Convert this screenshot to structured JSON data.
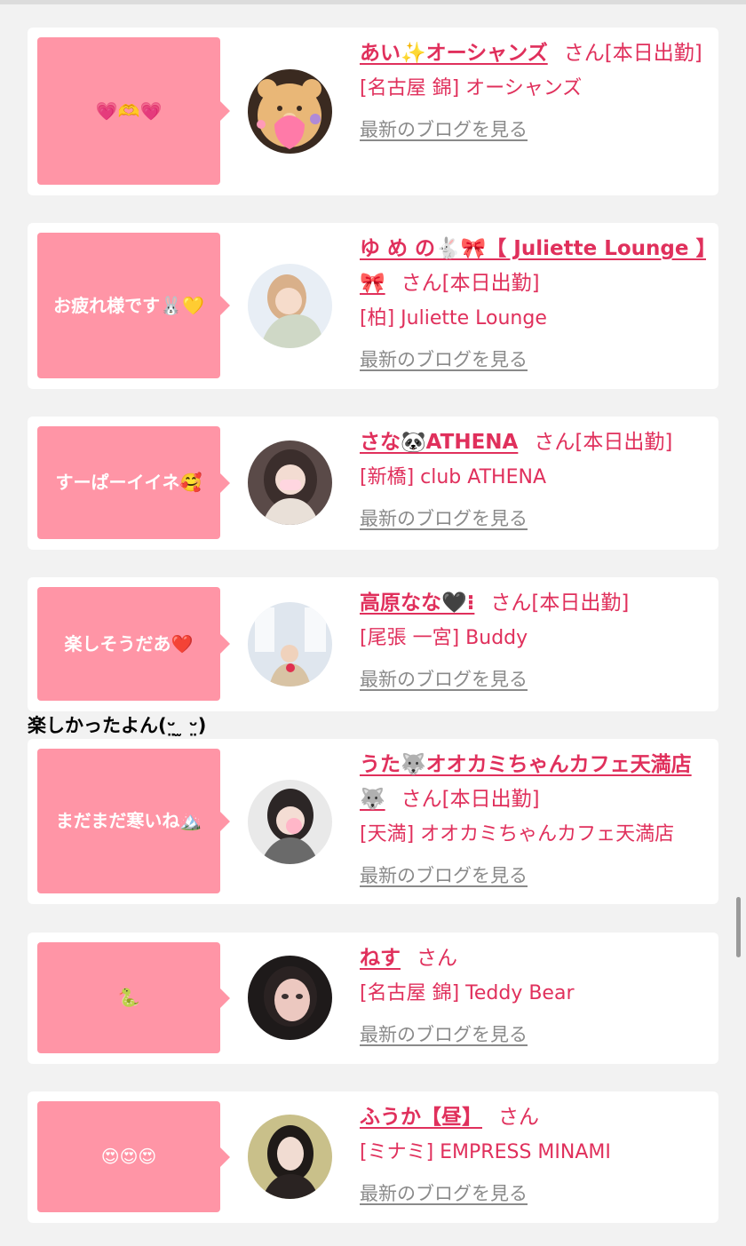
{
  "colors": {
    "accent": "#e0305c",
    "bubble": "#ff95a6",
    "link_gray": "#8a8a8a",
    "background": "#f2f2f2"
  },
  "blog_link_label": "最新のブログを見る",
  "overflow_text": "楽しかったよん(ᵕ̤ ̫ ᵕ̤)",
  "items": [
    {
      "message": "💗🫶💗",
      "name": "あい✨オーシャンズ",
      "status": "さん[本日出勤]",
      "shop": "[名古屋 錦] オーシャンズ",
      "avatar_icon": "bear-avatar"
    },
    {
      "message": "お疲れ様です🐰💛",
      "name": "ゆ め の🐇🎀【 Juliette Lounge 】🎀",
      "status": "さん[本日出勤]",
      "shop": "[柏] Juliette Lounge",
      "avatar_icon": "person-avatar"
    },
    {
      "message": "すーぱーイイネ🥰",
      "name": "さな🐼ATHENA",
      "status": "さん[本日出勤]",
      "shop": "[新橋] club ATHENA",
      "avatar_icon": "person-avatar"
    },
    {
      "message": "楽しそうだあ❤️",
      "name": "高原なな🖤⁝",
      "status": "さん[本日出勤]",
      "shop": "[尾張 一宮] Buddy",
      "avatar_icon": "person-avatar"
    },
    {
      "message": "まだまだ寒いね🏔️",
      "name": "うた🐺オオカミちゃんカフェ天満店🐺",
      "status": "さん[本日出勤]",
      "shop": "[天満] オオカミちゃんカフェ天満店",
      "avatar_icon": "person-avatar"
    },
    {
      "message": "🐍",
      "name": "ねす",
      "status": "さん",
      "shop": "[名古屋 錦] Teddy Bear",
      "avatar_icon": "person-avatar"
    },
    {
      "message": "😍😍😍",
      "name": "ふうか【昼】",
      "status": "さん",
      "shop": "[ミナミ] EMPRESS MINAMI",
      "avatar_icon": "person-avatar"
    }
  ]
}
